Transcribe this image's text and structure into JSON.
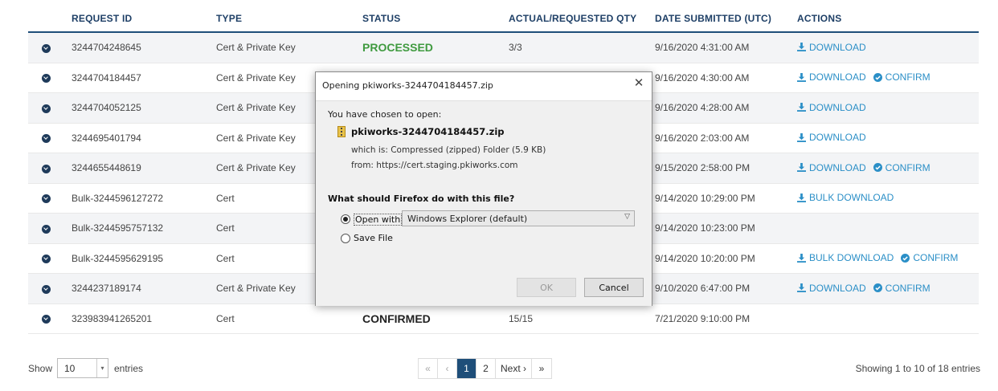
{
  "table": {
    "headers": [
      "REQUEST ID",
      "TYPE",
      "STATUS",
      "ACTUAL/REQUESTED QTY",
      "DATE SUBMITTED (UTC)",
      "ACTIONS"
    ],
    "rows": [
      {
        "id": "3244704248645",
        "type": "Cert & Private Key",
        "status": "PROCESSED",
        "qty": "3/3",
        "date": "9/16/2020 4:31:00 AM",
        "a1": "DOWNLOAD",
        "a2": ""
      },
      {
        "id": "3244704184457",
        "type": "Cert & Private Key",
        "status": "",
        "qty": "",
        "date": "9/16/2020 4:30:00 AM",
        "a1": "DOWNLOAD",
        "a2": "CONFIRM"
      },
      {
        "id": "3244704052125",
        "type": "Cert & Private Key",
        "status": "",
        "qty": "",
        "date": "9/16/2020 4:28:00 AM",
        "a1": "DOWNLOAD",
        "a2": ""
      },
      {
        "id": "3244695401794",
        "type": "Cert & Private Key",
        "status": "",
        "qty": "",
        "date": "9/16/2020 2:03:00 AM",
        "a1": "DOWNLOAD",
        "a2": ""
      },
      {
        "id": "3244655448619",
        "type": "Cert & Private Key",
        "status": "",
        "qty": "",
        "date": "9/15/2020 2:58:00 PM",
        "a1": "DOWNLOAD",
        "a2": "CONFIRM"
      },
      {
        "id": "Bulk-3244596127272",
        "type": "Cert",
        "status": "",
        "qty": "",
        "date": "9/14/2020 10:29:00 PM",
        "a1": "BULK DOWNLOAD",
        "a2": ""
      },
      {
        "id": "Bulk-3244595757132",
        "type": "Cert",
        "status": "",
        "qty": "",
        "date": "9/14/2020 10:23:00 PM",
        "a1": "",
        "a2": ""
      },
      {
        "id": "Bulk-3244595629195",
        "type": "Cert",
        "status": "",
        "qty": "",
        "date": "9/14/2020 10:20:00 PM",
        "a1": "BULK DOWNLOAD",
        "a2": "CONFIRM"
      },
      {
        "id": "3244237189174",
        "type": "Cert & Private Key",
        "status": "",
        "qty": "",
        "date": "9/10/2020 6:47:00 PM",
        "a1": "DOWNLOAD",
        "a2": "CONFIRM"
      },
      {
        "id": "323983941265201",
        "type": "Cert",
        "status": "CONFIRMED",
        "qty": "15/15",
        "date": "7/21/2020 9:10:00 PM",
        "a1": "",
        "a2": ""
      }
    ]
  },
  "footer": {
    "show_label": "Show",
    "page_length": "10",
    "entries_label": "entries",
    "pager": {
      "first": "«",
      "prev": "‹",
      "page1": "1",
      "page2": "2",
      "next": "Next ›",
      "last": "»"
    },
    "info": "Showing 1 to 10 of 18 entries"
  },
  "dialog": {
    "title": "Opening pkiworks-3244704184457.zip",
    "close": "✕",
    "chosen": "You have chosen to open:",
    "filename": "pkiworks-3244704184457.zip",
    "which": "which is: Compressed (zipped) Folder (5.9 KB)",
    "from": "from: https://cert.staging.pkiworks.com",
    "question": "What should Firefox do with this file?",
    "open_with_label": "Open with",
    "open_with_app": "Windows Explorer (default)",
    "save_label": "Save File",
    "ok": "OK",
    "cancel": "Cancel"
  },
  "colors": {
    "accent": "#2b8fc7",
    "header": "#1e3f66",
    "processed": "#3f9a3f",
    "pager_active": "#1e4e79"
  },
  "icons": {
    "row_toggle": "chevron-down-circle-icon",
    "download": "download-icon",
    "confirm": "check-circle-icon",
    "close": "close-icon",
    "file": "zip-file-icon"
  }
}
